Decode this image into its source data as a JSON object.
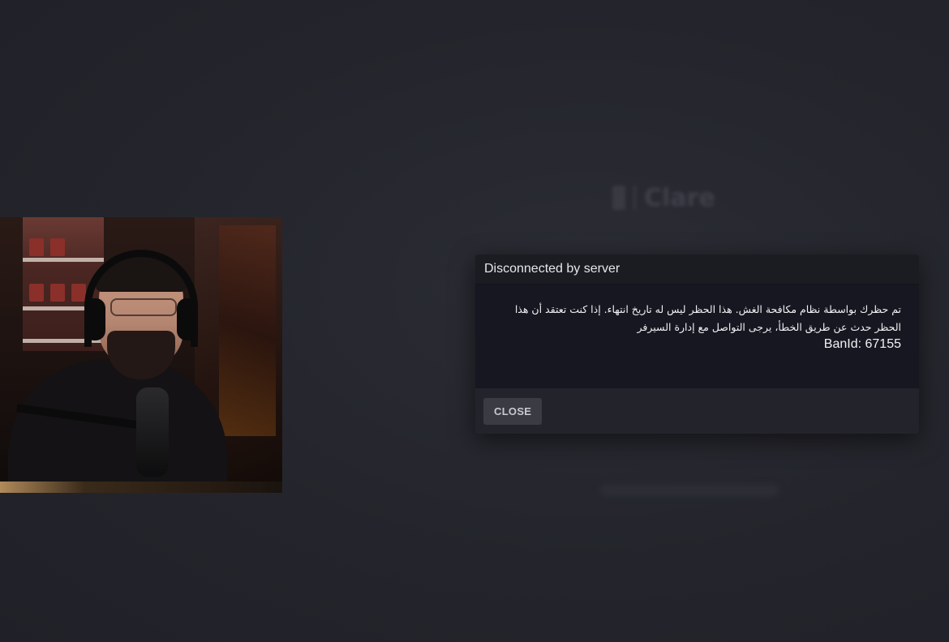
{
  "dialog": {
    "title": "Disconnected by server",
    "message": "تم حظرك بواسطة نظام مكافحة الغش. هذا الحظر ليس له تاريخ انتهاء. إذا كنت تعتقد أن هذا الحظر حدث عن طريق الخطأ، يرجى التواصل مع إدارة السيرفر",
    "ban_id": "BanId: 67155",
    "close_label": "CLOSE"
  },
  "background": {
    "logo_text": "Clare"
  },
  "colors": {
    "background": "#25262d",
    "dialog_body": "#161720",
    "dialog_header": "#1b1c22",
    "button": "#3a3b43"
  }
}
